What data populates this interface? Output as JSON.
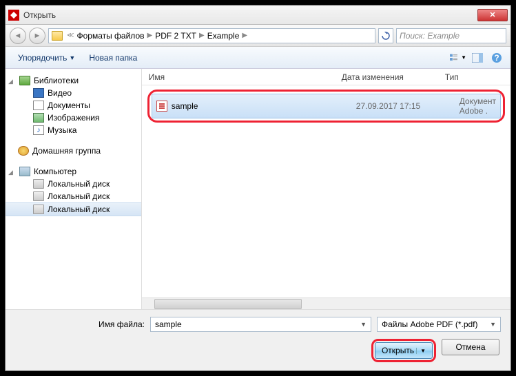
{
  "titlebar": {
    "title": "Открыть"
  },
  "breadcrumb": {
    "parts": [
      "Форматы файлов",
      "PDF 2 TXT",
      "Example"
    ]
  },
  "search": {
    "placeholder": "Поиск: Example"
  },
  "toolbar": {
    "organize": "Упорядочить",
    "newfolder": "Новая папка"
  },
  "sidebar": {
    "libraries": "Библиотеки",
    "video": "Видео",
    "documents": "Документы",
    "images": "Изображения",
    "music": "Музыка",
    "homegroup": "Домашняя группа",
    "computer": "Компьютер",
    "disk1": "Локальный диск",
    "disk2": "Локальный диск"
  },
  "columns": {
    "name": "Имя",
    "date": "Дата изменения",
    "type": "Тип"
  },
  "file": {
    "name": "sample",
    "date": "27.09.2017 17:15",
    "type": "Документ Adobe ."
  },
  "bottom": {
    "filename_label": "Имя файла:",
    "filename_value": "sample",
    "filetype": "Файлы Adobe PDF (*.pdf)",
    "open": "Открыть",
    "cancel": "Отмена"
  }
}
